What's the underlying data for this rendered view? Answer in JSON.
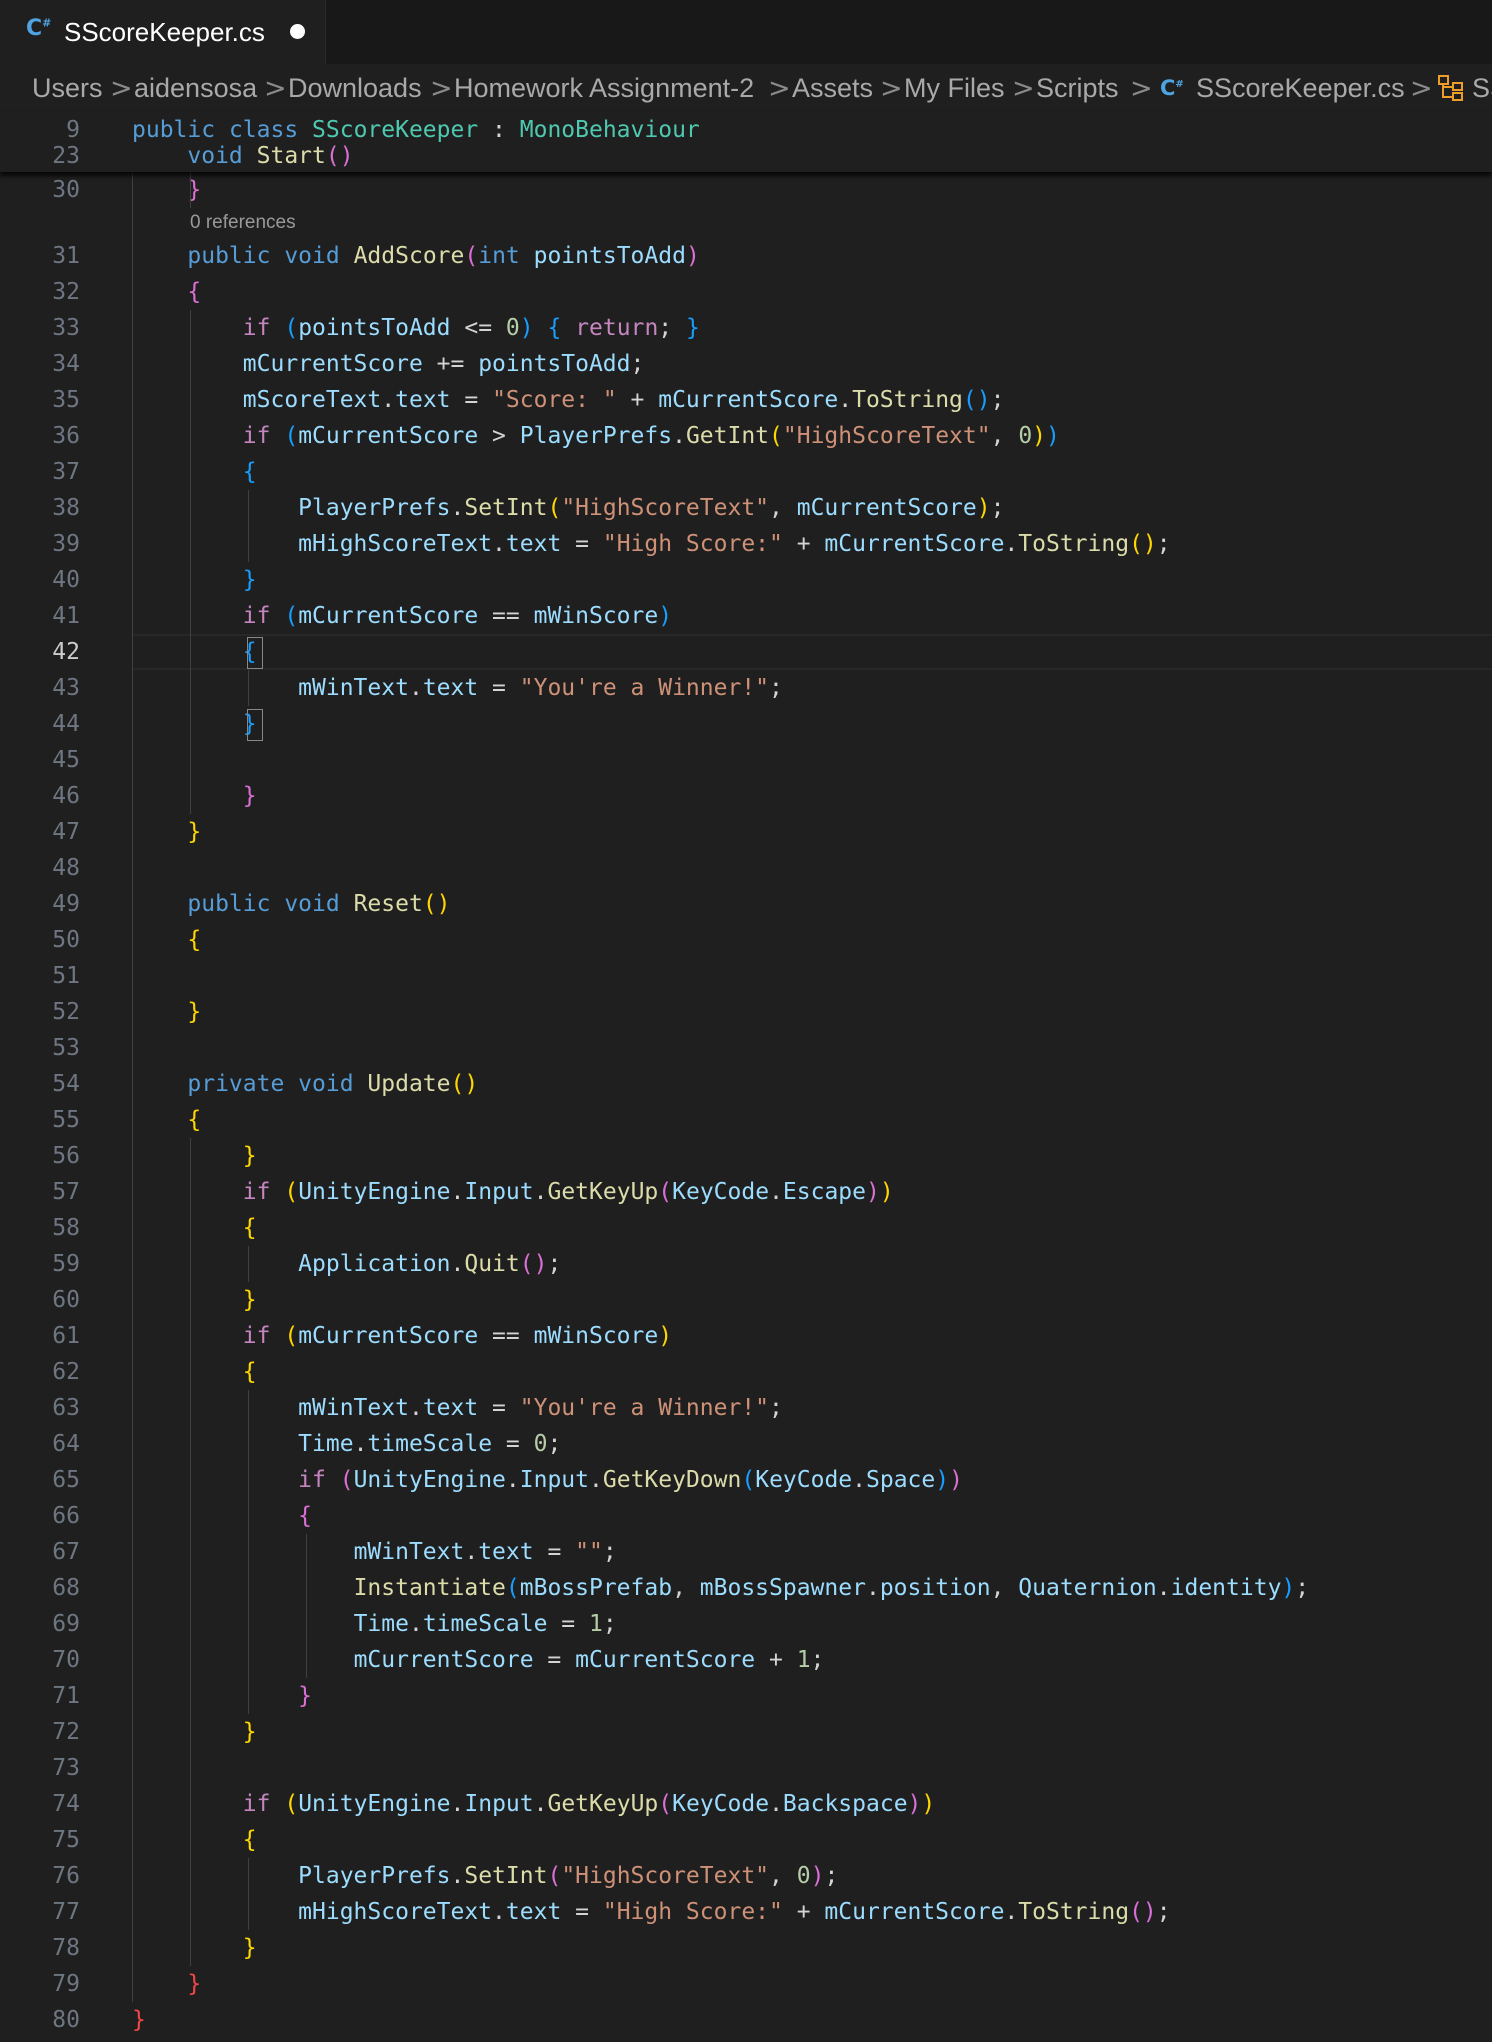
{
  "tab": {
    "icon": "csharp-file-icon",
    "icon_glyph": "C#",
    "title": "SScoreKeeper.cs",
    "modified_icon": "unsaved-dot-icon"
  },
  "breadcrumb": {
    "items": [
      "Users",
      "aidensosa",
      "Downloads",
      "Homework Assignment-2",
      "Assets",
      "My Files",
      "Scripts",
      "SScoreKeeper.cs",
      "SS"
    ],
    "separator": ">",
    "file_icon": "csharp-file-icon",
    "symbol_icon": "class-symbol-icon"
  },
  "codelens": "0 references",
  "active_line": "42",
  "sticky_lines": [
    {
      "num": "9",
      "tokens": [
        [
          "k",
          "public "
        ],
        [
          "k",
          "class "
        ],
        [
          "t",
          "SScoreKeeper"
        ],
        [
          "p",
          " : "
        ],
        [
          "t",
          "MonoBehaviour"
        ]
      ]
    },
    {
      "num": "23",
      "tokens": [
        [
          "p",
          "    "
        ],
        [
          "k",
          "void "
        ],
        [
          "f",
          "Start"
        ],
        [
          "b2",
          "()"
        ]
      ]
    }
  ],
  "lines": [
    {
      "num": "30",
      "tokens": [
        [
          "p",
          "    "
        ],
        [
          "b2",
          "}"
        ]
      ]
    },
    {
      "num": "31",
      "tokens": [
        [
          "p",
          "    "
        ],
        [
          "k",
          "public "
        ],
        [
          "k",
          "void "
        ],
        [
          "f",
          "AddScore"
        ],
        [
          "b2",
          "("
        ],
        [
          "k",
          "int "
        ],
        [
          "v",
          "pointsToAdd"
        ],
        [
          "b2",
          ")"
        ]
      ]
    },
    {
      "num": "32",
      "tokens": [
        [
          "p",
          "    "
        ],
        [
          "b2",
          "{"
        ]
      ]
    },
    {
      "num": "33",
      "tokens": [
        [
          "p",
          "        "
        ],
        [
          "c",
          "if "
        ],
        [
          "b3",
          "("
        ],
        [
          "v",
          "pointsToAdd"
        ],
        [
          "p",
          " <= "
        ],
        [
          "n",
          "0"
        ],
        [
          "b3",
          ")"
        ],
        [
          "p",
          " "
        ],
        [
          "b3",
          "{"
        ],
        [
          "p",
          " "
        ],
        [
          "c",
          "return"
        ],
        [
          "p",
          "; "
        ],
        [
          "b3",
          "}"
        ]
      ]
    },
    {
      "num": "34",
      "tokens": [
        [
          "p",
          "        "
        ],
        [
          "v",
          "mCurrentScore"
        ],
        [
          "p",
          " += "
        ],
        [
          "v",
          "pointsToAdd"
        ],
        [
          "p",
          ";"
        ]
      ]
    },
    {
      "num": "35",
      "tokens": [
        [
          "p",
          "        "
        ],
        [
          "v",
          "mScoreText"
        ],
        [
          "p",
          "."
        ],
        [
          "v",
          "text"
        ],
        [
          "p",
          " = "
        ],
        [
          "s",
          "\"Score: \""
        ],
        [
          "p",
          " + "
        ],
        [
          "v",
          "mCurrentScore"
        ],
        [
          "p",
          "."
        ],
        [
          "f",
          "ToString"
        ],
        [
          "b3",
          "()"
        ],
        [
          "p",
          ";"
        ]
      ]
    },
    {
      "num": "36",
      "tokens": [
        [
          "p",
          "        "
        ],
        [
          "c",
          "if "
        ],
        [
          "b3",
          "("
        ],
        [
          "v",
          "mCurrentScore"
        ],
        [
          "p",
          " > "
        ],
        [
          "v",
          "PlayerPrefs"
        ],
        [
          "p",
          "."
        ],
        [
          "f",
          "GetInt"
        ],
        [
          "b1",
          "("
        ],
        [
          "s",
          "\"HighScoreText\""
        ],
        [
          "p",
          ", "
        ],
        [
          "n",
          "0"
        ],
        [
          "b1",
          ")"
        ],
        [
          "b3",
          ")"
        ]
      ]
    },
    {
      "num": "37",
      "tokens": [
        [
          "p",
          "        "
        ],
        [
          "b3",
          "{"
        ]
      ]
    },
    {
      "num": "38",
      "tokens": [
        [
          "p",
          "            "
        ],
        [
          "v",
          "PlayerPrefs"
        ],
        [
          "p",
          "."
        ],
        [
          "f",
          "SetInt"
        ],
        [
          "b1",
          "("
        ],
        [
          "s",
          "\"HighScoreText\""
        ],
        [
          "p",
          ", "
        ],
        [
          "v",
          "mCurrentScore"
        ],
        [
          "b1",
          ")"
        ],
        [
          "p",
          ";"
        ]
      ]
    },
    {
      "num": "39",
      "tokens": [
        [
          "p",
          "            "
        ],
        [
          "v",
          "mHighScoreText"
        ],
        [
          "p",
          "."
        ],
        [
          "v",
          "text"
        ],
        [
          "p",
          " = "
        ],
        [
          "s",
          "\"High Score:\""
        ],
        [
          "p",
          " + "
        ],
        [
          "v",
          "mCurrentScore"
        ],
        [
          "p",
          "."
        ],
        [
          "f",
          "ToString"
        ],
        [
          "b1",
          "()"
        ],
        [
          "p",
          ";"
        ]
      ]
    },
    {
      "num": "40",
      "tokens": [
        [
          "p",
          "        "
        ],
        [
          "b3",
          "}"
        ]
      ]
    },
    {
      "num": "41",
      "tokens": [
        [
          "p",
          "        "
        ],
        [
          "c",
          "if "
        ],
        [
          "b3",
          "("
        ],
        [
          "v",
          "mCurrentScore"
        ],
        [
          "p",
          " == "
        ],
        [
          "v",
          "mWinScore"
        ],
        [
          "b3",
          ")"
        ]
      ]
    },
    {
      "num": "42",
      "tokens": [
        [
          "p",
          "        "
        ],
        [
          "b3",
          "{"
        ]
      ]
    },
    {
      "num": "43",
      "tokens": [
        [
          "p",
          "            "
        ],
        [
          "v",
          "mWinText"
        ],
        [
          "p",
          "."
        ],
        [
          "v",
          "text"
        ],
        [
          "p",
          " = "
        ],
        [
          "s",
          "\"You're a Winner!\""
        ],
        [
          "p",
          ";"
        ]
      ]
    },
    {
      "num": "44",
      "tokens": [
        [
          "p",
          "        "
        ],
        [
          "b3",
          "}"
        ]
      ]
    },
    {
      "num": "45",
      "tokens": []
    },
    {
      "num": "46",
      "tokens": [
        [
          "p",
          "        "
        ],
        [
          "b2",
          "}"
        ]
      ]
    },
    {
      "num": "47",
      "tokens": [
        [
          "p",
          "    "
        ],
        [
          "b1",
          "}"
        ]
      ]
    },
    {
      "num": "48",
      "tokens": []
    },
    {
      "num": "49",
      "tokens": [
        [
          "p",
          "    "
        ],
        [
          "k",
          "public "
        ],
        [
          "k",
          "void "
        ],
        [
          "f",
          "Reset"
        ],
        [
          "b1",
          "()"
        ]
      ]
    },
    {
      "num": "50",
      "tokens": [
        [
          "p",
          "    "
        ],
        [
          "b1",
          "{"
        ]
      ]
    },
    {
      "num": "51",
      "tokens": []
    },
    {
      "num": "52",
      "tokens": [
        [
          "p",
          "    "
        ],
        [
          "b1",
          "}"
        ]
      ]
    },
    {
      "num": "53",
      "tokens": []
    },
    {
      "num": "54",
      "tokens": [
        [
          "p",
          "    "
        ],
        [
          "k",
          "private "
        ],
        [
          "k",
          "void "
        ],
        [
          "f",
          "Update"
        ],
        [
          "b1",
          "()"
        ]
      ]
    },
    {
      "num": "55",
      "tokens": [
        [
          "p",
          "    "
        ],
        [
          "b1",
          "{"
        ]
      ]
    },
    {
      "num": "56",
      "tokens": [
        [
          "p",
          "        "
        ],
        [
          "b1",
          "}"
        ]
      ]
    },
    {
      "num": "57",
      "tokens": [
        [
          "p",
          "        "
        ],
        [
          "c",
          "if "
        ],
        [
          "b1",
          "("
        ],
        [
          "v",
          "UnityEngine"
        ],
        [
          "p",
          "."
        ],
        [
          "v",
          "Input"
        ],
        [
          "p",
          "."
        ],
        [
          "f",
          "GetKeyUp"
        ],
        [
          "b2",
          "("
        ],
        [
          "v",
          "KeyCode"
        ],
        [
          "p",
          "."
        ],
        [
          "v",
          "Escape"
        ],
        [
          "b2",
          ")"
        ],
        [
          "b1",
          ")"
        ]
      ]
    },
    {
      "num": "58",
      "tokens": [
        [
          "p",
          "        "
        ],
        [
          "b1",
          "{"
        ]
      ]
    },
    {
      "num": "59",
      "tokens": [
        [
          "p",
          "            "
        ],
        [
          "v",
          "Application"
        ],
        [
          "p",
          "."
        ],
        [
          "f",
          "Quit"
        ],
        [
          "b2",
          "()"
        ],
        [
          "p",
          ";"
        ]
      ]
    },
    {
      "num": "60",
      "tokens": [
        [
          "p",
          "        "
        ],
        [
          "b1",
          "}"
        ]
      ]
    },
    {
      "num": "61",
      "tokens": [
        [
          "p",
          "        "
        ],
        [
          "c",
          "if "
        ],
        [
          "b1",
          "("
        ],
        [
          "v",
          "mCurrentScore"
        ],
        [
          "p",
          " == "
        ],
        [
          "v",
          "mWinScore"
        ],
        [
          "b1",
          ")"
        ]
      ]
    },
    {
      "num": "62",
      "tokens": [
        [
          "p",
          "        "
        ],
        [
          "b1",
          "{"
        ]
      ]
    },
    {
      "num": "63",
      "tokens": [
        [
          "p",
          "            "
        ],
        [
          "v",
          "mWinText"
        ],
        [
          "p",
          "."
        ],
        [
          "v",
          "text"
        ],
        [
          "p",
          " = "
        ],
        [
          "s",
          "\"You're a Winner!\""
        ],
        [
          "p",
          ";"
        ]
      ]
    },
    {
      "num": "64",
      "tokens": [
        [
          "p",
          "            "
        ],
        [
          "v",
          "Time"
        ],
        [
          "p",
          "."
        ],
        [
          "v",
          "timeScale"
        ],
        [
          "p",
          " = "
        ],
        [
          "n",
          "0"
        ],
        [
          "p",
          ";"
        ]
      ]
    },
    {
      "num": "65",
      "tokens": [
        [
          "p",
          "            "
        ],
        [
          "c",
          "if "
        ],
        [
          "b2",
          "("
        ],
        [
          "v",
          "UnityEngine"
        ],
        [
          "p",
          "."
        ],
        [
          "v",
          "Input"
        ],
        [
          "p",
          "."
        ],
        [
          "f",
          "GetKeyDown"
        ],
        [
          "b3",
          "("
        ],
        [
          "v",
          "KeyCode"
        ],
        [
          "p",
          "."
        ],
        [
          "v",
          "Space"
        ],
        [
          "b3",
          ")"
        ],
        [
          "b2",
          ")"
        ]
      ]
    },
    {
      "num": "66",
      "tokens": [
        [
          "p",
          "            "
        ],
        [
          "b2",
          "{"
        ]
      ]
    },
    {
      "num": "67",
      "tokens": [
        [
          "p",
          "                "
        ],
        [
          "v",
          "mWinText"
        ],
        [
          "p",
          "."
        ],
        [
          "v",
          "text"
        ],
        [
          "p",
          " = "
        ],
        [
          "s",
          "\"\""
        ],
        [
          "p",
          ";"
        ]
      ]
    },
    {
      "num": "68",
      "tokens": [
        [
          "p",
          "                "
        ],
        [
          "f",
          "Instantiate"
        ],
        [
          "b3",
          "("
        ],
        [
          "v",
          "mBossPrefab"
        ],
        [
          "p",
          ", "
        ],
        [
          "v",
          "mBossSpawner"
        ],
        [
          "p",
          "."
        ],
        [
          "v",
          "position"
        ],
        [
          "p",
          ", "
        ],
        [
          "v",
          "Quaternion"
        ],
        [
          "p",
          "."
        ],
        [
          "v",
          "identity"
        ],
        [
          "b3",
          ")"
        ],
        [
          "p",
          ";"
        ]
      ]
    },
    {
      "num": "69",
      "tokens": [
        [
          "p",
          "                "
        ],
        [
          "v",
          "Time"
        ],
        [
          "p",
          "."
        ],
        [
          "v",
          "timeScale"
        ],
        [
          "p",
          " = "
        ],
        [
          "n",
          "1"
        ],
        [
          "p",
          ";"
        ]
      ]
    },
    {
      "num": "70",
      "tokens": [
        [
          "p",
          "                "
        ],
        [
          "v",
          "mCurrentScore"
        ],
        [
          "p",
          " = "
        ],
        [
          "v",
          "mCurrentScore"
        ],
        [
          "p",
          " + "
        ],
        [
          "n",
          "1"
        ],
        [
          "p",
          ";"
        ]
      ]
    },
    {
      "num": "71",
      "tokens": [
        [
          "p",
          "            "
        ],
        [
          "b2",
          "}"
        ]
      ]
    },
    {
      "num": "72",
      "tokens": [
        [
          "p",
          "        "
        ],
        [
          "b1",
          "}"
        ]
      ]
    },
    {
      "num": "73",
      "tokens": []
    },
    {
      "num": "74",
      "tokens": [
        [
          "p",
          "        "
        ],
        [
          "c",
          "if "
        ],
        [
          "b1",
          "("
        ],
        [
          "v",
          "UnityEngine"
        ],
        [
          "p",
          "."
        ],
        [
          "v",
          "Input"
        ],
        [
          "p",
          "."
        ],
        [
          "f",
          "GetKeyUp"
        ],
        [
          "b2",
          "("
        ],
        [
          "v",
          "KeyCode"
        ],
        [
          "p",
          "."
        ],
        [
          "v",
          "Backspace"
        ],
        [
          "b2",
          ")"
        ],
        [
          "b1",
          ")"
        ]
      ]
    },
    {
      "num": "75",
      "tokens": [
        [
          "p",
          "        "
        ],
        [
          "b1",
          "{"
        ]
      ]
    },
    {
      "num": "76",
      "tokens": [
        [
          "p",
          "            "
        ],
        [
          "v",
          "PlayerPrefs"
        ],
        [
          "p",
          "."
        ],
        [
          "f",
          "SetInt"
        ],
        [
          "b2",
          "("
        ],
        [
          "s",
          "\"HighScoreText\""
        ],
        [
          "p",
          ", "
        ],
        [
          "n",
          "0"
        ],
        [
          "b2",
          ")"
        ],
        [
          "p",
          ";"
        ]
      ]
    },
    {
      "num": "77",
      "tokens": [
        [
          "p",
          "            "
        ],
        [
          "v",
          "mHighScoreText"
        ],
        [
          "p",
          "."
        ],
        [
          "v",
          "text"
        ],
        [
          "p",
          " = "
        ],
        [
          "s",
          "\"High Score:\""
        ],
        [
          "p",
          " + "
        ],
        [
          "v",
          "mCurrentScore"
        ],
        [
          "p",
          "."
        ],
        [
          "f",
          "ToString"
        ],
        [
          "b2",
          "()"
        ],
        [
          "p",
          ";"
        ]
      ]
    },
    {
      "num": "78",
      "tokens": [
        [
          "p",
          "        "
        ],
        [
          "b1",
          "}"
        ]
      ]
    },
    {
      "num": "79",
      "tokens": [
        [
          "p",
          "    "
        ],
        [
          "br",
          "}"
        ]
      ]
    },
    {
      "num": "80",
      "tokens": [
        [
          "br",
          "}"
        ]
      ]
    }
  ]
}
